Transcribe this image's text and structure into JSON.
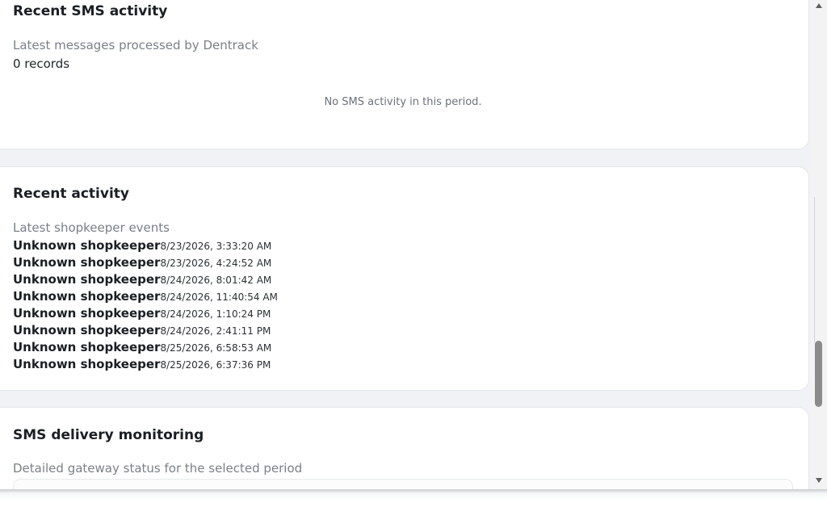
{
  "sms_activity": {
    "title": "Recent SMS activity",
    "subtitle": "Latest messages processed by Dentrack",
    "records": "0 records",
    "empty_message": "No SMS activity in this period."
  },
  "recent_activity": {
    "title": "Recent activity",
    "subtitle": "Latest shopkeeper events",
    "items": [
      {
        "name": "Unknown shopkeeper",
        "time": "8/23/2026, 3:33:20 AM"
      },
      {
        "name": "Unknown shopkeeper",
        "time": "8/23/2026, 4:24:52 AM"
      },
      {
        "name": "Unknown shopkeeper",
        "time": "8/24/2026, 8:01:42 AM"
      },
      {
        "name": "Unknown shopkeeper",
        "time": "8/24/2026, 11:40:54 AM"
      },
      {
        "name": "Unknown shopkeeper",
        "time": "8/24/2026, 1:10:24 PM"
      },
      {
        "name": "Unknown shopkeeper",
        "time": "8/24/2026, 2:41:11 PM"
      },
      {
        "name": "Unknown shopkeeper",
        "time": "8/25/2026, 6:58:53 AM"
      },
      {
        "name": "Unknown shopkeeper",
        "time": "8/25/2026, 6:37:36 PM"
      }
    ]
  },
  "sms_delivery": {
    "title": "SMS delivery monitoring",
    "subtitle": "Detailed gateway status for the selected period"
  },
  "scrollbar": {
    "up_icon": "triangle-up",
    "down_icon": "triangle-down"
  }
}
